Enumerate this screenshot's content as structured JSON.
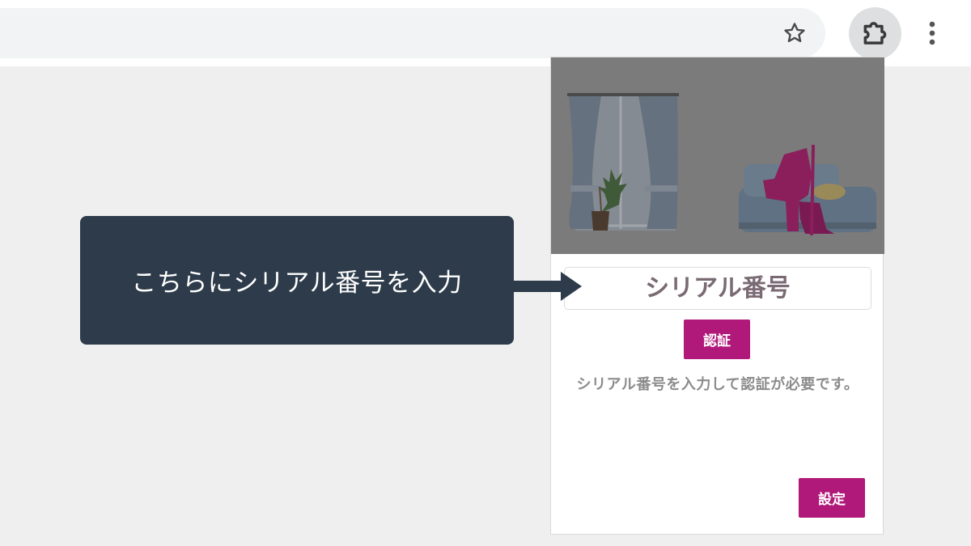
{
  "toolbar": {
    "icons": {
      "bookmark": "star-icon",
      "extensions": "puzzle-icon",
      "menu": "kebab-menu-icon"
    }
  },
  "popup": {
    "serial_placeholder": "シリアル番号",
    "auth_label": "認証",
    "help_text": "シリアル番号を入力して認証が必要です。",
    "settings_label": "設定"
  },
  "callout": {
    "text": "こちらにシリアル番号を入力"
  },
  "colors": {
    "accent": "#b0197a",
    "callout_bg": "#2d3b4a",
    "page_bg": "#efefef"
  }
}
